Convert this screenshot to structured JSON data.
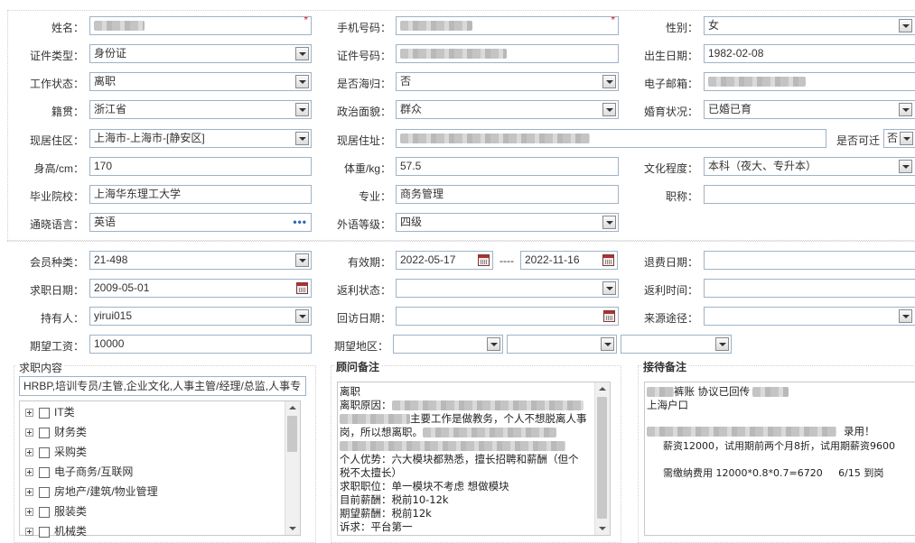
{
  "form": {
    "name_label": "姓名：",
    "phone_label": "手机号码：",
    "gender_label": "性别：",
    "gender_value": "女",
    "id_type_label": "证件类型：",
    "id_type_value": "身份证",
    "id_no_label": "证件号码：",
    "birth_label": "出生日期：",
    "birth_value": "1982-02-08",
    "work_status_label": "工作状态：",
    "work_status_value": "离职",
    "returnee_label": "是否海归：",
    "returnee_value": "否",
    "email_label": "电子邮箱：",
    "native_label": "籍贯：",
    "native_value": "浙江省",
    "political_label": "政治面貌：",
    "political_value": "群众",
    "marital_label": "婚育状况：",
    "marital_value": "已婚已育",
    "residence_label": "现居住区：",
    "residence_value": "上海市-上海市-[静安区]",
    "address_label": "现居住址：",
    "relocate_label": "是否可迁",
    "relocate_value": "否",
    "height_label": "身高/cm：",
    "height_value": "170",
    "weight_label": "体重/kg：",
    "weight_value": "57.5",
    "education_label": "文化程度：",
    "education_value": "本科（夜大、专升本）",
    "school_label": "毕业院校：",
    "school_value": "上海华东理工大学",
    "major_label": "专业：",
    "major_value": "商务管理",
    "title_label": "职称：",
    "language_label": "通晓语言：",
    "language_value": "英语",
    "lang_level_label": "外语等级：",
    "lang_level_value": "四级"
  },
  "member": {
    "type_label": "会员种类：",
    "type_value": "21-498",
    "valid_label": "有效期：",
    "valid_from": "2022-05-17",
    "valid_sep": "----",
    "valid_to": "2022-11-16",
    "refund_label": "退费日期：",
    "job_date_label": "求职日期：",
    "job_date_value": "2009-05-01",
    "rebate_status_label": "返利状态：",
    "rebate_time_label": "返利时间：",
    "holder_label": "持有人：",
    "holder_value": "yirui015",
    "visit_label": "回访日期：",
    "source_label": "来源途径：",
    "salary_label": "期望工资：",
    "salary_value": "10000",
    "area_label": "期望地区："
  },
  "job_panel": {
    "title": "求职内容",
    "summary": "HRBP,培训专员/主管,企业文化,人事主管/经理/总监,人事专",
    "categories": [
      "IT类",
      "财务类",
      "采购类",
      "电子商务/互联网",
      "房地产/建筑/物业管理",
      "服装类",
      "机械类"
    ]
  },
  "advisor_panel": {
    "title": "顾问备注",
    "lines": [
      "离职",
      "离职原因：",
      "主要工作是做教务，个人不想脱离人事",
      "岗，所以想离职。",
      "",
      "个人优势：六大模块都熟悉，擅长招聘和薪酬（但个",
      "税不太擅长）",
      "求职职位：单一模块不考虑 想做模块",
      "目前薪酬：税前10-12k",
      "期望薪酬：税前12k",
      "诉求：平台第一"
    ]
  },
  "reception_panel": {
    "title": "接待备注",
    "line1": "裤账 协议已回传",
    "line2": "上海户口",
    "line3": "录用！",
    "line4": "薪资12000，试用期前两个月8折，试用期薪资9600",
    "line5": "需缴纳费用 12000*0.8*0.7=6720     6/15 到岗"
  }
}
